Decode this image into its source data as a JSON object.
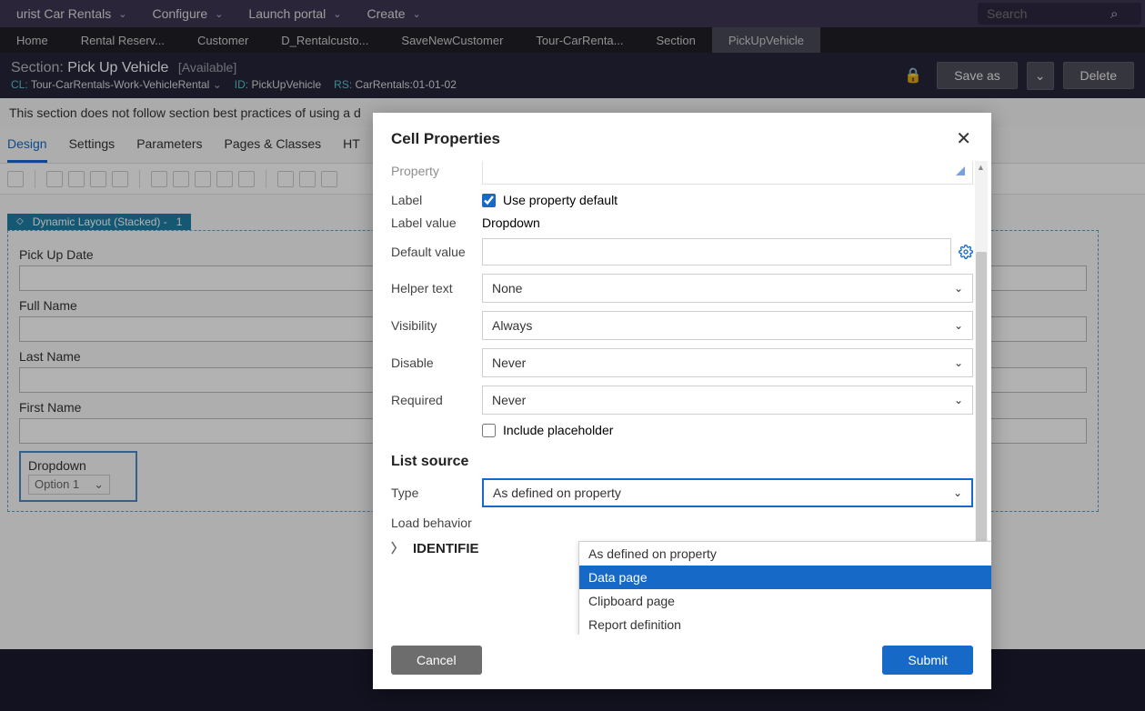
{
  "topmenu": {
    "app": "urist Car Rentals",
    "configure": "Configure",
    "launch": "Launch portal",
    "create": "Create",
    "search_placeholder": "Search"
  },
  "tabs": [
    "Home",
    "Rental Reserv...",
    "Customer",
    "D_Rentalcusto...",
    "SaveNewCustomer",
    "Tour-CarRenta...",
    "Section",
    "PickUpVehicle"
  ],
  "activeTab": 7,
  "ruleheader": {
    "title_prefix": "Section:",
    "title": "Pick Up Vehicle",
    "status": "[Available]",
    "cl_label": "CL:",
    "cl": "Tour-CarRentals-Work-VehicleRental",
    "id_label": "ID:",
    "id": "PickUpVehicle",
    "rs_label": "RS:",
    "rs": "CarRentals:01-01-02",
    "saveas": "Save as",
    "delete": "Delete"
  },
  "warnline": "This section does not follow section best practices of using a d",
  "ruletabs": [
    "Design",
    "Settings",
    "Parameters",
    "Pages & Classes",
    "HT"
  ],
  "activeRuleTab": 0,
  "layout": {
    "chip": "Dynamic Layout (Stacked) -",
    "chipnum": "1",
    "fields": [
      "Pick Up Date",
      "Full Name",
      "Last Name",
      "First Name"
    ],
    "dropdown_label": "Dropdown",
    "dropdown_value": "Option 1"
  },
  "modal": {
    "title": "Cell Properties",
    "rows": {
      "property": "Property",
      "label": "Label",
      "label_cb": "Use property default",
      "label_value_lbl": "Label value",
      "label_value": "Dropdown",
      "default_value": "Default value",
      "helper": "Helper text",
      "helper_val": "None",
      "visibility": "Visibility",
      "visibility_val": "Always",
      "disable": "Disable",
      "disable_val": "Never",
      "required": "Required",
      "required_val": "Never",
      "include_ph": "Include placeholder",
      "list_source": "List source",
      "type": "Type",
      "type_val": "As defined on property",
      "load": "Load behavior",
      "identifiers": "IDENTIFIE",
      "options": [
        "As defined on property",
        "Data page",
        "Clipboard page",
        "Report definition"
      ],
      "highlighted": 1
    },
    "cancel": "Cancel",
    "submit": "Submit"
  }
}
